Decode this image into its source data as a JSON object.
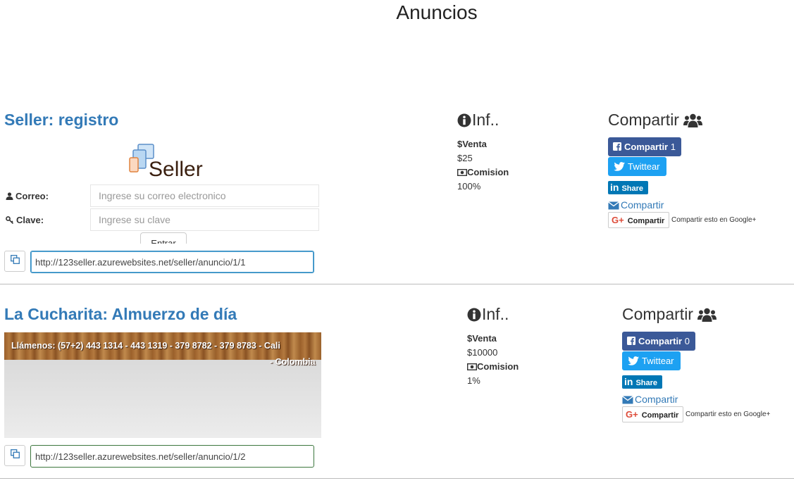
{
  "page": {
    "title": "Anuncios"
  },
  "ads": [
    {
      "title": "Seller: registro",
      "preview": {
        "logo_text": "Seller",
        "form": {
          "email_label": "Correo:",
          "email_placeholder": "Ingrese su correo electronico",
          "password_label": "Clave:",
          "password_placeholder": "Ingrese su clave",
          "submit_label": "Entrar"
        }
      },
      "info": {
        "heading": "Inf..",
        "venta_label": "$Venta",
        "venta_value": "$25",
        "comision_label": "Comision",
        "comision_value": "100%"
      },
      "share": {
        "heading": "Compartir",
        "facebook_label": "Compartir",
        "facebook_count": "1",
        "twitter_label": "Twittear",
        "linkedin_label": "Share",
        "email_label": "Compartir",
        "gplus_label": "Compartir",
        "gplus_text": "Compartir esto en Google+"
      },
      "url": "http://123seller.azurewebsites.net/seller/anuncio/1/1"
    },
    {
      "title": "La Cucharita: Almuerzo de día",
      "preview": {
        "banner_line1": "Llámenos: (57+2) 443 1314 - 443 1319 - 379 8782 - 379 8783 - Cali",
        "banner_line2": "- Colombia"
      },
      "info": {
        "heading": "Inf..",
        "venta_label": "$Venta",
        "venta_value": "$10000",
        "comision_label": "Comision",
        "comision_value": "1%"
      },
      "share": {
        "heading": "Compartir",
        "facebook_label": "Compartir",
        "facebook_count": "0",
        "twitter_label": "Twittear",
        "linkedin_label": "Share",
        "email_label": "Compartir",
        "gplus_label": "Compartir",
        "gplus_text": "Compartir esto en Google+"
      },
      "url": "http://123seller.azurewebsites.net/seller/anuncio/1/2"
    }
  ],
  "icons": {
    "info": "info-circle-icon",
    "money": "money-icon",
    "users": "users-icon",
    "facebook": "facebook-icon",
    "twitter": "twitter-icon",
    "linkedin": "linkedin-icon",
    "envelope": "envelope-icon",
    "gplus": "google-plus-icon",
    "copy": "copy-icon",
    "user": "user-icon",
    "key": "key-icon"
  },
  "colors": {
    "link": "#337ab7",
    "facebook": "#3b5998",
    "twitter": "#1da1f2",
    "linkedin": "#0077b5",
    "gplus": "#dd4b39",
    "input_border": "#3c763d"
  }
}
